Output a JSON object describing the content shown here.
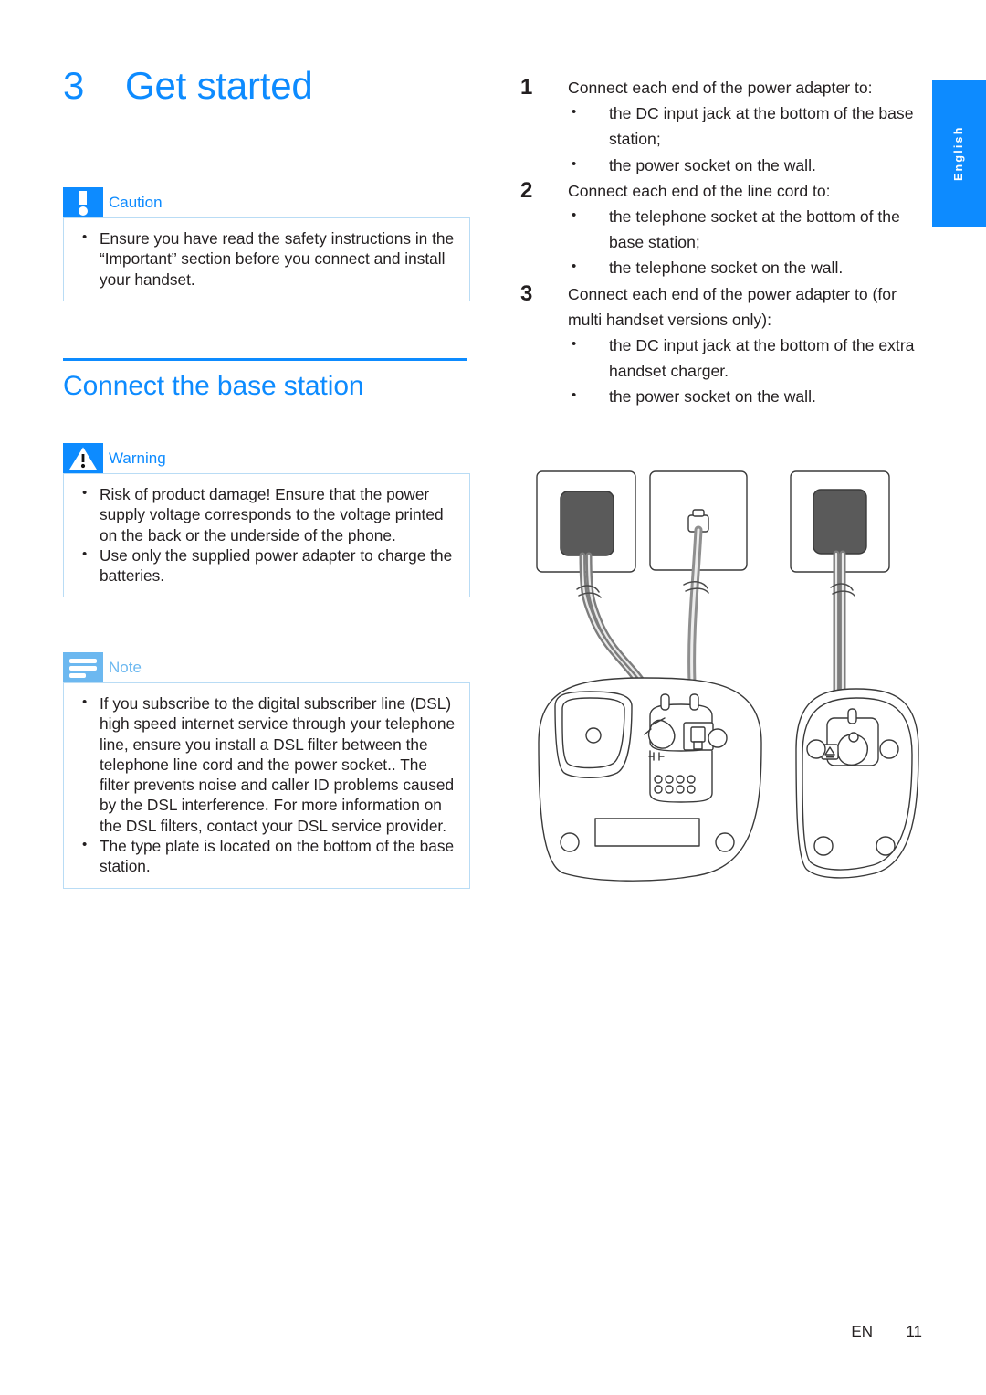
{
  "language_tab": {
    "label": "English"
  },
  "chapter": {
    "number": "3",
    "title": "Get started"
  },
  "caution": {
    "icon": "caution-icon",
    "title": "Caution",
    "items": [
      "Ensure you have read the safety instructions in the “Important” section before you connect and install your handset."
    ]
  },
  "section": {
    "title": "Connect the base station"
  },
  "warning": {
    "icon": "warning-icon",
    "title": "Warning",
    "items": [
      "Risk of product damage! Ensure that the power supply voltage corresponds to the voltage printed on the back or the underside of the phone.",
      "Use only the supplied power adapter to charge the batteries."
    ]
  },
  "note": {
    "icon": "note-icon",
    "title": "Note",
    "items": [
      "If you subscribe to the digital subscriber line (DSL) high speed internet service through your telephone line, ensure you install a DSL filter between the telephone line cord and the power socket.. The filter prevents noise and caller ID problems caused by the DSL interference. For more information on the DSL filters, contact your DSL service provider.",
      "The type plate is located on the bottom of the base station."
    ]
  },
  "steps": [
    {
      "number": "1",
      "text": "Connect each end of the power adapter to:",
      "substeps": [
        "the DC input jack at the bottom of the base station;",
        "the power socket on the wall."
      ]
    },
    {
      "number": "2",
      "text": "Connect each end of the line cord to:",
      "substeps": [
        "the telephone socket at the bottom of the base station;",
        "the telephone socket on the wall."
      ]
    },
    {
      "number": "3",
      "text": "Connect each end of the power adapter to (for multi handset versions only):",
      "substeps": [
        "the DC input jack at the bottom of the extra handset charger.",
        "the power socket on the wall."
      ]
    }
  ],
  "diagram": {
    "name": "base-station-connection-diagram",
    "elements": [
      "wall-plate-power-left",
      "wall-plate-telephone-middle",
      "wall-plate-power-right",
      "power-adapter-left",
      "telephone-connector",
      "power-adapter-right",
      "base-station-underside",
      "handset-charger-underside"
    ]
  },
  "footer": {
    "locale": "EN",
    "page": "11"
  },
  "colors": {
    "accent_blue": "#0d8bff",
    "note_blue": "#6cb8f0",
    "box_border": "#b9dcf5",
    "text": "#231f20",
    "adapter_fill": "#5a5a5a",
    "line_stroke": "#3a3a3a"
  }
}
